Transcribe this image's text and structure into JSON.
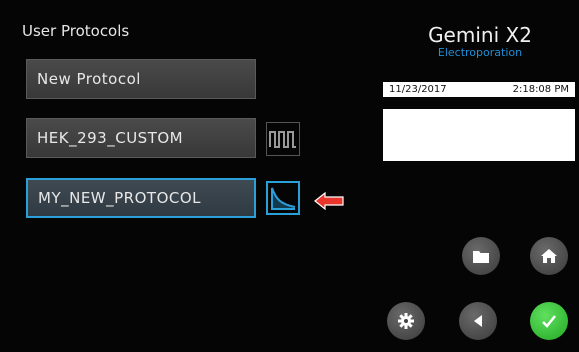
{
  "screen": {
    "title": "User Protocols",
    "brand": {
      "name": "Gemini X2",
      "subtitle": "Electroporation"
    }
  },
  "protocols": [
    {
      "label": "New Protocol",
      "waveform": null,
      "selected": false
    },
    {
      "label": "HEK_293_CUSTOM",
      "waveform": "square-wave-icon",
      "selected": false
    },
    {
      "label": "MY_NEW_PROTOCOL",
      "waveform": "exponential-decay-icon",
      "selected": true
    }
  ],
  "status": {
    "date": "11/23/2017",
    "time": "2:18:08 PM"
  },
  "controls": {
    "folder": "folder-icon",
    "home": "home-icon",
    "settings": "gear-icon",
    "back": "back-arrow-icon",
    "confirm": "checkmark-icon"
  },
  "colors": {
    "selection": "#2a9fd8",
    "brand_subtitle": "#1f8fd8",
    "confirm": "#2fc02f",
    "pointer_arrow": "#e8342a"
  }
}
